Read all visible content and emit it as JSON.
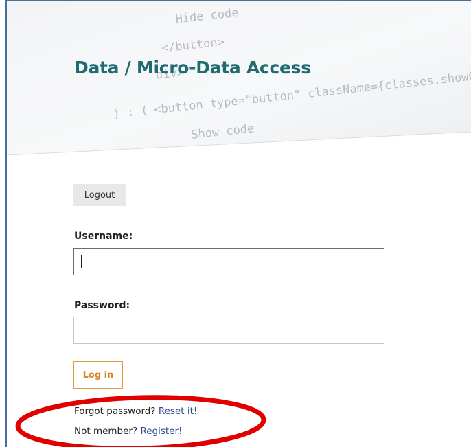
{
  "banner": {
    "code_lines": [
      "Hide code",
      "</button>",
      "div>",
      ") : (",
      "<button type=\"button\" className={classes.showCode}",
      "Show code"
    ]
  },
  "page": {
    "title": "Data / Micro-Data Access"
  },
  "toolbar": {
    "logout_label": "Logout"
  },
  "form": {
    "username_label": "Username:",
    "username_value": "",
    "password_label": "Password:",
    "password_value": "",
    "login_label": "Log in"
  },
  "help": {
    "forgot_prefix": "Forgot password?",
    "reset_link": "Reset it!",
    "member_prefix": "Not member?",
    "register_link": "Register!"
  },
  "colors": {
    "title": "#1f6b70",
    "login_accent": "#e39a3c",
    "link": "#2b4b8c",
    "annotation": "#e00000",
    "frame": "#4a6f96"
  }
}
